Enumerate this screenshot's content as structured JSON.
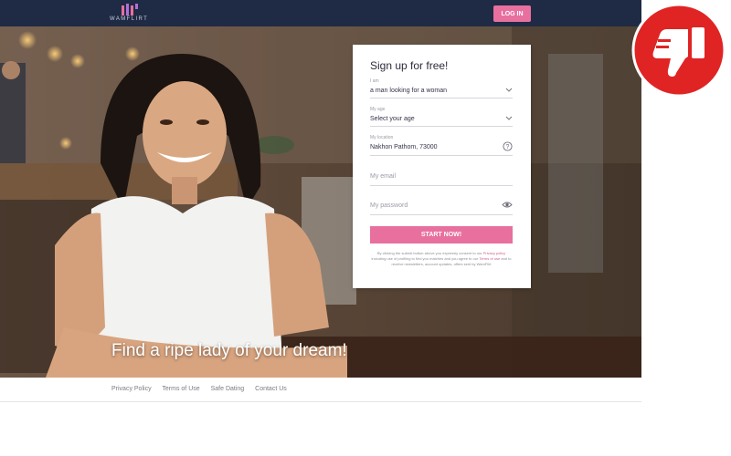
{
  "header": {
    "logo_text": "WAMFLIRT",
    "login_label": "LOG IN"
  },
  "hero": {
    "headline": "Find a ripe lady of your dream!"
  },
  "signup": {
    "title": "Sign up for free!",
    "i_am": {
      "label": "I am",
      "value": "a man looking for a woman"
    },
    "age": {
      "label": "My age",
      "value": "Select your age"
    },
    "location": {
      "label": "My location",
      "value": "Nakhon Pathom, 73000"
    },
    "email": {
      "placeholder": "My email"
    },
    "password": {
      "placeholder": "My password"
    },
    "start_label": "START NOW!",
    "legal": {
      "part1": "By clicking the submit button above you expressly consent to our",
      "privacy_link": "Privacy policy",
      "part2": "including use of profiling to find you matches and you agree to our",
      "terms_link": "Terms of use",
      "part3": "and to receive newsletters, account updates, offers sent by WamFlirt"
    }
  },
  "footer": {
    "links": [
      "Privacy Policy",
      "Terms of Use",
      "Safe Dating",
      "Contact Us"
    ]
  },
  "badge": {
    "icon": "thumbs-down-icon",
    "color": "#e02424"
  },
  "colors": {
    "navbar": "#1f2a44",
    "accent": "#e8709f"
  }
}
